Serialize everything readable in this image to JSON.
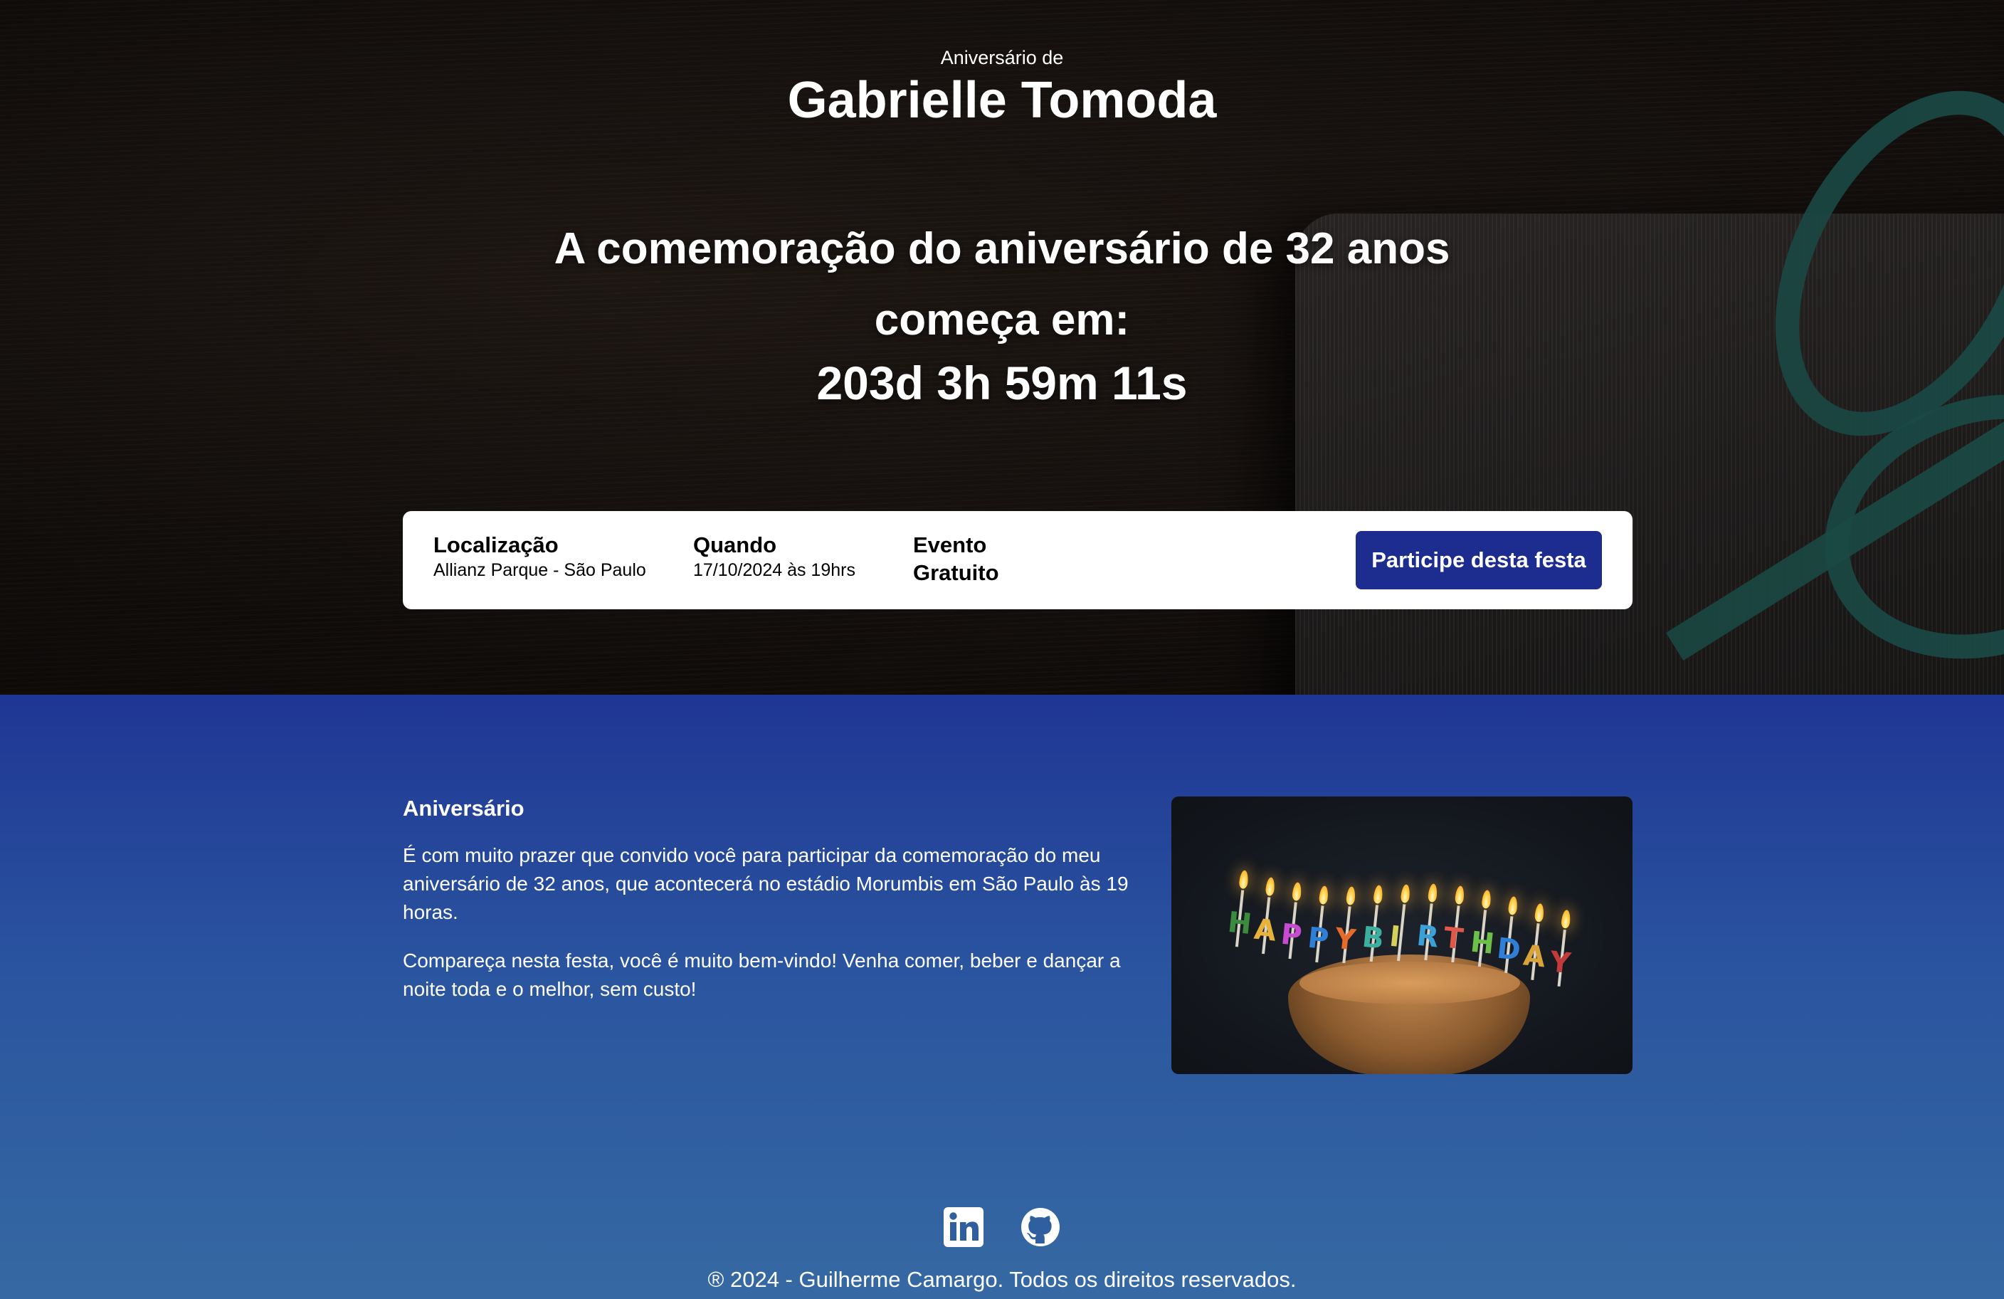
{
  "hero": {
    "subtitle": "Aniversário de",
    "name": "Gabrielle Tomoda",
    "countdown_title": "A comemoração do aniversário de 32 anos começa em:",
    "countdown": "203d 3h 59m 11s"
  },
  "info": {
    "location_label": "Localização",
    "location_value": "Allianz Parque - São Paulo",
    "when_label": "Quando",
    "when_value": "17/10/2024 às 19hrs",
    "event_label": "Evento",
    "event_value": "Gratuito",
    "cta_label": "Participe desta festa"
  },
  "about": {
    "title": "Aniversário",
    "paragraphs": [
      "É com muito prazer que convido você para participar da comemoração do meu aniversário de 32 anos, que acontecerá no estádio Morumbis em São Paulo às 19 horas.",
      "Compareça nesta festa, você é muito bem-vindo! Venha comer, beber e dançar a noite toda e o melhor, sem custo!"
    ],
    "image_letters": [
      "H",
      "A",
      "P",
      "P",
      "Y",
      "B",
      "I",
      "R",
      "T",
      "H",
      "D",
      "A",
      "Y"
    ]
  },
  "footer": {
    "icons": [
      "linkedin-icon",
      "github-icon"
    ],
    "copyright": "® 2024 - Guilherme Camargo. Todos os direitos reservados."
  },
  "colors": {
    "cta_bg": "#1c2d8f",
    "about_gradient_top": "#1f3694",
    "about_gradient_bottom": "#3669a3",
    "ribbon": "#1f5651"
  }
}
